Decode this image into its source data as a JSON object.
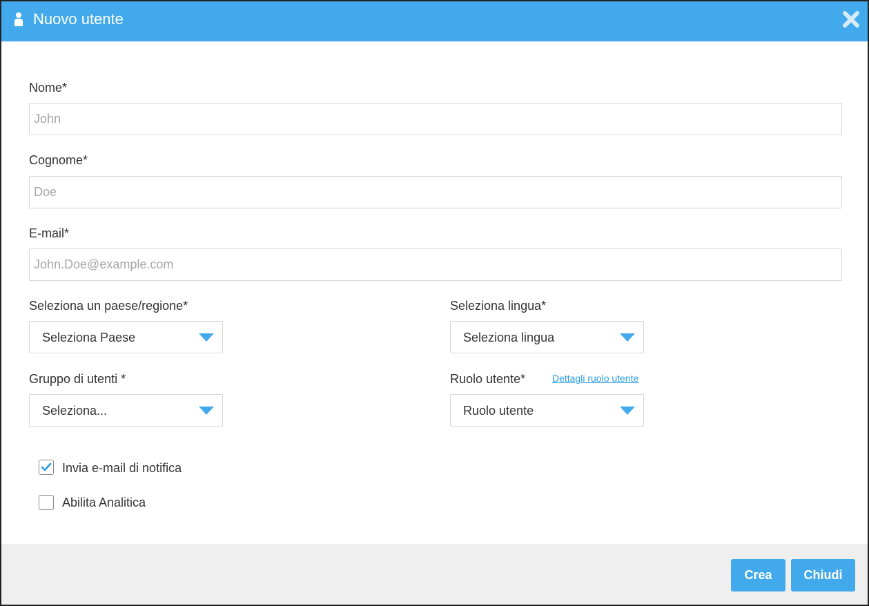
{
  "dialog": {
    "title": "Nuovo utente",
    "icons": {
      "title": "user-icon",
      "close": "close-icon"
    },
    "colors": {
      "accent": "#42aaec",
      "link": "#2b9be3",
      "footer": "#efefef"
    }
  },
  "form": {
    "first_name": {
      "label": "Nome*",
      "placeholder": "John",
      "value": ""
    },
    "last_name": {
      "label": "Cognome*",
      "placeholder": "Doe",
      "value": ""
    },
    "email": {
      "label": "E-mail*",
      "placeholder": "John.Doe@example.com",
      "value": ""
    },
    "country": {
      "label": "Seleziona un paese/regione*",
      "selected": "Seleziona Paese"
    },
    "language": {
      "label": "Seleziona lingua*",
      "selected": "Seleziona lingua"
    },
    "user_group": {
      "label": "Gruppo di utenti *",
      "selected": "Seleziona..."
    },
    "user_role": {
      "label": "Ruolo utente*",
      "selected": "Ruolo utente",
      "details_link": "Dettagli ruolo utente"
    },
    "notify_email": {
      "label": "Invia e-mail di notifica",
      "checked": true
    },
    "enable_analytics": {
      "label": "Abilita Analitica",
      "checked": false
    }
  },
  "footer": {
    "create_label": "Crea",
    "close_label": "Chiudi"
  }
}
